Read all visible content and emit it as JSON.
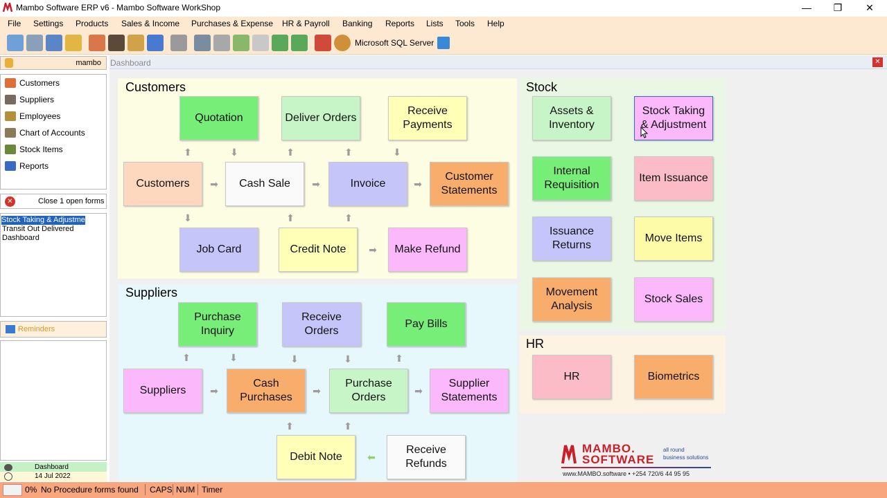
{
  "window": {
    "title": "Mambo Software ERP v6 - Mambo Software WorkShop",
    "minimize": "—",
    "restore": "❐",
    "close": "✕"
  },
  "menu": [
    "File",
    "Settings",
    "Products",
    "Sales & Income",
    "Purchases & Expense",
    "HR & Payroll",
    "Banking",
    "Reports",
    "Lists",
    "Tools",
    "Help"
  ],
  "toolbar": {
    "server_label": "Microsoft SQL Server",
    "icons": [
      "home-icon",
      "tools-icon",
      "wrench-icon",
      "calculator-icon",
      "people-icon",
      "person-icon",
      "eraser-icon",
      "tag-icon",
      "printer-icon",
      "print-preview-icon",
      "printer2-icon",
      "export-icon",
      "copy-icon",
      "import-icon",
      "export2-icon",
      "puzzle-icon",
      "user-icon",
      "mail-icon"
    ]
  },
  "left": {
    "user": "mambo",
    "nav": [
      {
        "label": "Customers",
        "icon": "customers-icon",
        "color": "#e06d3a"
      },
      {
        "label": "Suppliers",
        "icon": "suppliers-icon",
        "color": "#7a6a5a"
      },
      {
        "label": "Employees",
        "icon": "employees-icon",
        "color": "#b58f3a"
      },
      {
        "label": "Chart of Accounts",
        "icon": "chart-icon",
        "color": "#8a7a5a"
      },
      {
        "label": "Stock Items",
        "icon": "stock-icon",
        "color": "#6a8a3a"
      },
      {
        "label": "Reports",
        "icon": "reports-icon",
        "color": "#3a6ac4"
      }
    ],
    "close_forms": "Close 1 open forms",
    "open_forms": [
      "Stock Taking & Adjustment",
      "Transit Out Delivered",
      "Dashboard"
    ],
    "reminders": "Reminders",
    "bottom_item1": "Dashboard",
    "bottom_item2": "14 Jul 2022"
  },
  "main": {
    "header": "Dashboard",
    "customers": {
      "title": "Customers",
      "tiles": {
        "quotation": "Quotation",
        "deliver": "Deliver Orders",
        "receive_payments": "Receive\nPayments",
        "customers": "Customers",
        "cash_sale": "Cash Sale",
        "invoice": "Invoice",
        "statements": "Customer\nStatements",
        "job_card": "Job Card",
        "credit_note": "Credit Note",
        "make_refund": "Make Refund"
      }
    },
    "suppliers": {
      "title": "Suppliers",
      "tiles": {
        "purchase_inquiry": "Purchase\nInquiry",
        "receive_orders": "Receive\nOrders",
        "pay_bills": "Pay Bills",
        "suppliers": "Suppliers",
        "cash_purchases": "Cash\nPurchases",
        "purchase_orders": "Purchase\nOrders",
        "supplier_statements": "Supplier\nStatements",
        "debit_note": "Debit Note",
        "receive_refunds": "Receive\nRefunds"
      }
    },
    "stock": {
      "title": "Stock",
      "tiles": {
        "assets": "Assets &\nInventory",
        "stock_taking": "Stock Taking\n& Adjustment",
        "internal_req": "Internal\nRequisition",
        "item_issuance": "Item Issuance",
        "issuance_returns": "Issuance\nReturns",
        "move_items": "Move Items",
        "movement_analysis": "Movement\nAnalysis",
        "stock_sales": "Stock Sales"
      }
    },
    "hr": {
      "title": "HR",
      "tiles": {
        "hr": "HR",
        "biometrics": "Biometrics"
      }
    },
    "brand": {
      "name1": "MAMBO.",
      "name2": "SOFTWARE",
      "tag1": "all round",
      "tag2": "business solutions",
      "contact": "www.MAMBO.software • +254 720/6 44 95 95"
    }
  },
  "status": {
    "percent": "0%",
    "message": "No Procedure forms found",
    "caps": "CAPS",
    "num": "NUM",
    "timer": "Timer"
  },
  "colors": {
    "green": "#77ee77",
    "lightgreen": "#c8f5c8",
    "yellow": "#ffffb8",
    "peach": "#fdd8bf",
    "white": "#fafafa",
    "lavender": "#c5c5fa",
    "orange": "#f9ad6c",
    "pink": "#fbb9fb",
    "rose": "#fbbcc8",
    "lemon": "#fdfba8"
  }
}
